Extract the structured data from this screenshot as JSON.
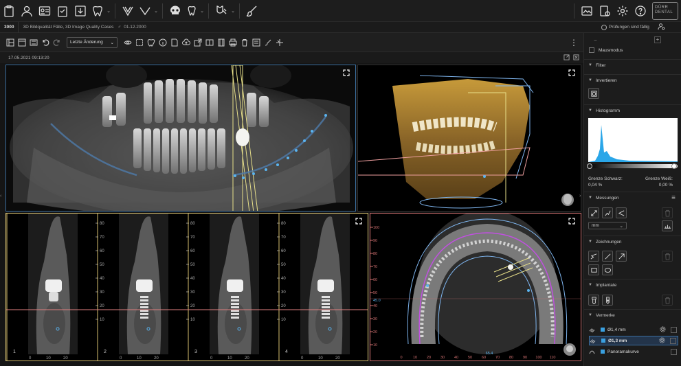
{
  "toolbar": {
    "left_icons": [
      "clipboard-icon",
      "patient-icon",
      "patient-card-icon",
      "checklist-icon",
      "import-icon",
      "tooth-icon",
      "jaw-icon",
      "skull-icon",
      "implant-icon",
      "brush-icon"
    ],
    "right_icons": [
      "image-icon",
      "report-icon",
      "settings-icon",
      "help-icon"
    ],
    "logo_line1": "DÜRR",
    "logo_line2": "DENTAL"
  },
  "infobar": {
    "patient_id": "3000",
    "patient_name": "3D Bildqualität Fälle, 3D Image Quality Cases",
    "gender": "♂",
    "birthdate": "01.12.2000",
    "checks_due": "Prüfungen sind fällig"
  },
  "subtoolbar": {
    "undo_select": "Letzte Änderung"
  },
  "view": {
    "timestamp": "17.05.2021 09:13:20"
  },
  "cross_sections": {
    "ruler_ticks": [
      "80",
      "70",
      "60",
      "50",
      "40",
      "30",
      "20",
      "10"
    ],
    "x_ticks": [
      "0",
      "10",
      "20"
    ],
    "slice_numbers": [
      "1",
      "2",
      "3",
      "4"
    ]
  },
  "axial": {
    "y_ticks": [
      "100",
      "90",
      "80",
      "70",
      "60",
      "50",
      "40",
      "30",
      "20",
      "10"
    ],
    "x_ticks": [
      "0",
      "10",
      "20",
      "30",
      "40",
      "50",
      "60",
      "70",
      "80",
      "90",
      "100",
      "110"
    ],
    "y_marker": "45.0",
    "x_marker": "65.4"
  },
  "sidebar": {
    "mouse_mode": "Mausmodus",
    "sections": {
      "filter": "Filter",
      "invert": "Invertieren",
      "histogram": "Histogramm",
      "measurements": "Messungen",
      "drawings": "Zeichnungen",
      "implants": "Implantate",
      "notes": "Vermerke"
    },
    "histogram": {
      "black_label": "Grenze Schwarz:",
      "black_value": "0,04 %",
      "white_label": "Grenze Weiß:",
      "white_value": "0,00 %",
      "accent": "#2aa6e8"
    },
    "unit_select": "mm",
    "notes": [
      {
        "label": "Ø1,4 mm"
      },
      {
        "label": "Ø1,3 mm"
      },
      {
        "label": "Panoramakurve"
      }
    ]
  }
}
